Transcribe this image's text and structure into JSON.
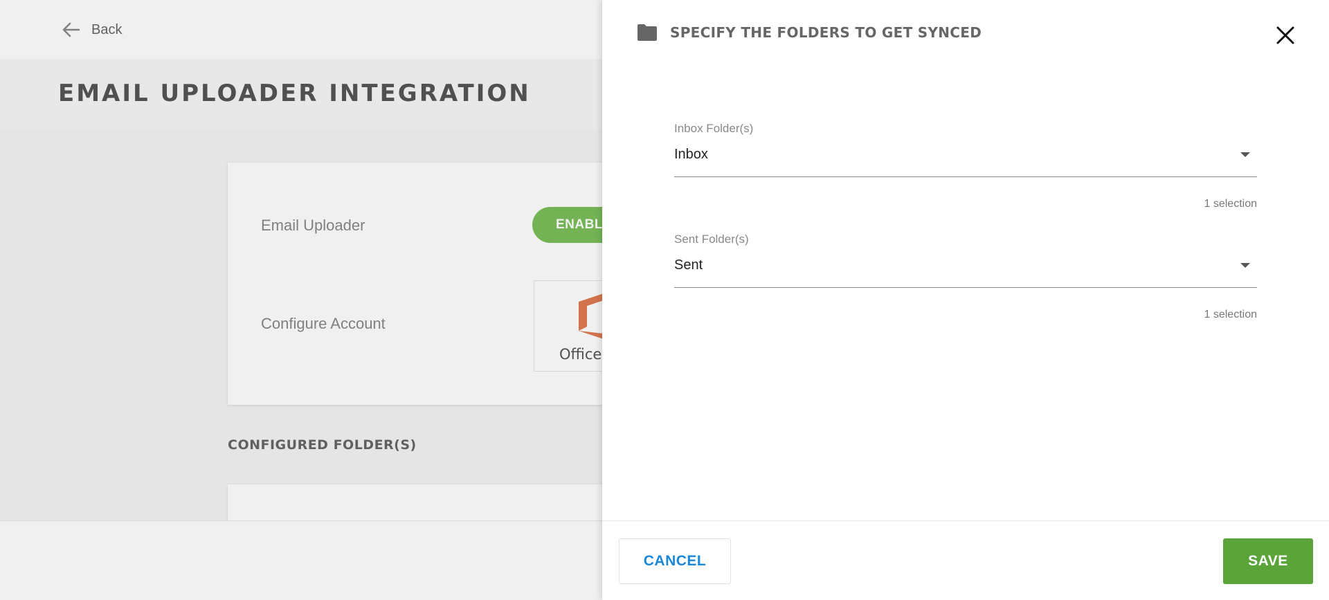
{
  "background": {
    "back_label": "Back",
    "page_title": "EMAIL UPLOADER INTEGRATION",
    "email_uploader_label": "Email Uploader",
    "enabled_badge": "ENABLED",
    "configure_account_label": "Configure Account",
    "office_label": "Office",
    "configured_folders_title": "CONFIGURED FOLDER(S)"
  },
  "panel": {
    "title": "SPECIFY THE FOLDERS TO GET SYNCED",
    "icons": {
      "header": "folder-icon",
      "close": "close-icon"
    },
    "fields": [
      {
        "label": "Inbox Folder(s)",
        "value": "Inbox",
        "helper": "1 selection"
      },
      {
        "label": "Sent Folder(s)",
        "value": "Sent",
        "helper": "1 selection"
      }
    ],
    "cancel_label": "CANCEL",
    "save_label": "SAVE"
  },
  "colors": {
    "save_button": "#5aa43a",
    "cancel_text": "#1a87d9",
    "enabled_badge": "#7bbf5a",
    "office_logo": "#e07b53"
  }
}
